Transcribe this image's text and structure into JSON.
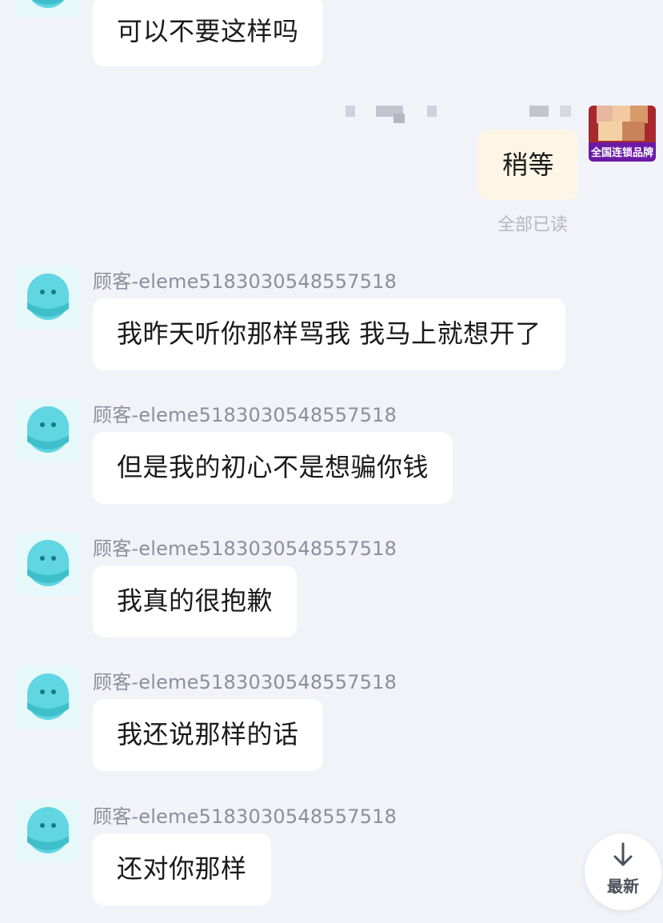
{
  "messages": [
    {
      "type": "customer",
      "sender": "",
      "text": "可以不要这样吗"
    },
    {
      "type": "self",
      "text": "稍等",
      "status": "全部已读",
      "shop_badge": "全国连锁品牌"
    },
    {
      "type": "customer",
      "sender": "顾客-eleme5183030548557518",
      "text": "我昨天听你那样骂我 我马上就想开了"
    },
    {
      "type": "customer",
      "sender": "顾客-eleme5183030548557518",
      "text": "但是我的初心不是想骗你钱"
    },
    {
      "type": "customer",
      "sender": "顾客-eleme5183030548557518",
      "text": "我真的很抱歉"
    },
    {
      "type": "customer",
      "sender": "顾客-eleme5183030548557518",
      "text": "我还说那样的话"
    },
    {
      "type": "customer",
      "sender": "顾客-eleme5183030548557518",
      "text": "还对你那样"
    }
  ],
  "scroll_button": {
    "label": "最新",
    "icon": "arrow-down-icon"
  },
  "colors": {
    "background": "#f1f3f9",
    "customer_bubble": "#ffffff",
    "self_bubble": "#fdf6e6",
    "avatar_face": "#52d3df",
    "shop_badge": "#a8282e"
  }
}
